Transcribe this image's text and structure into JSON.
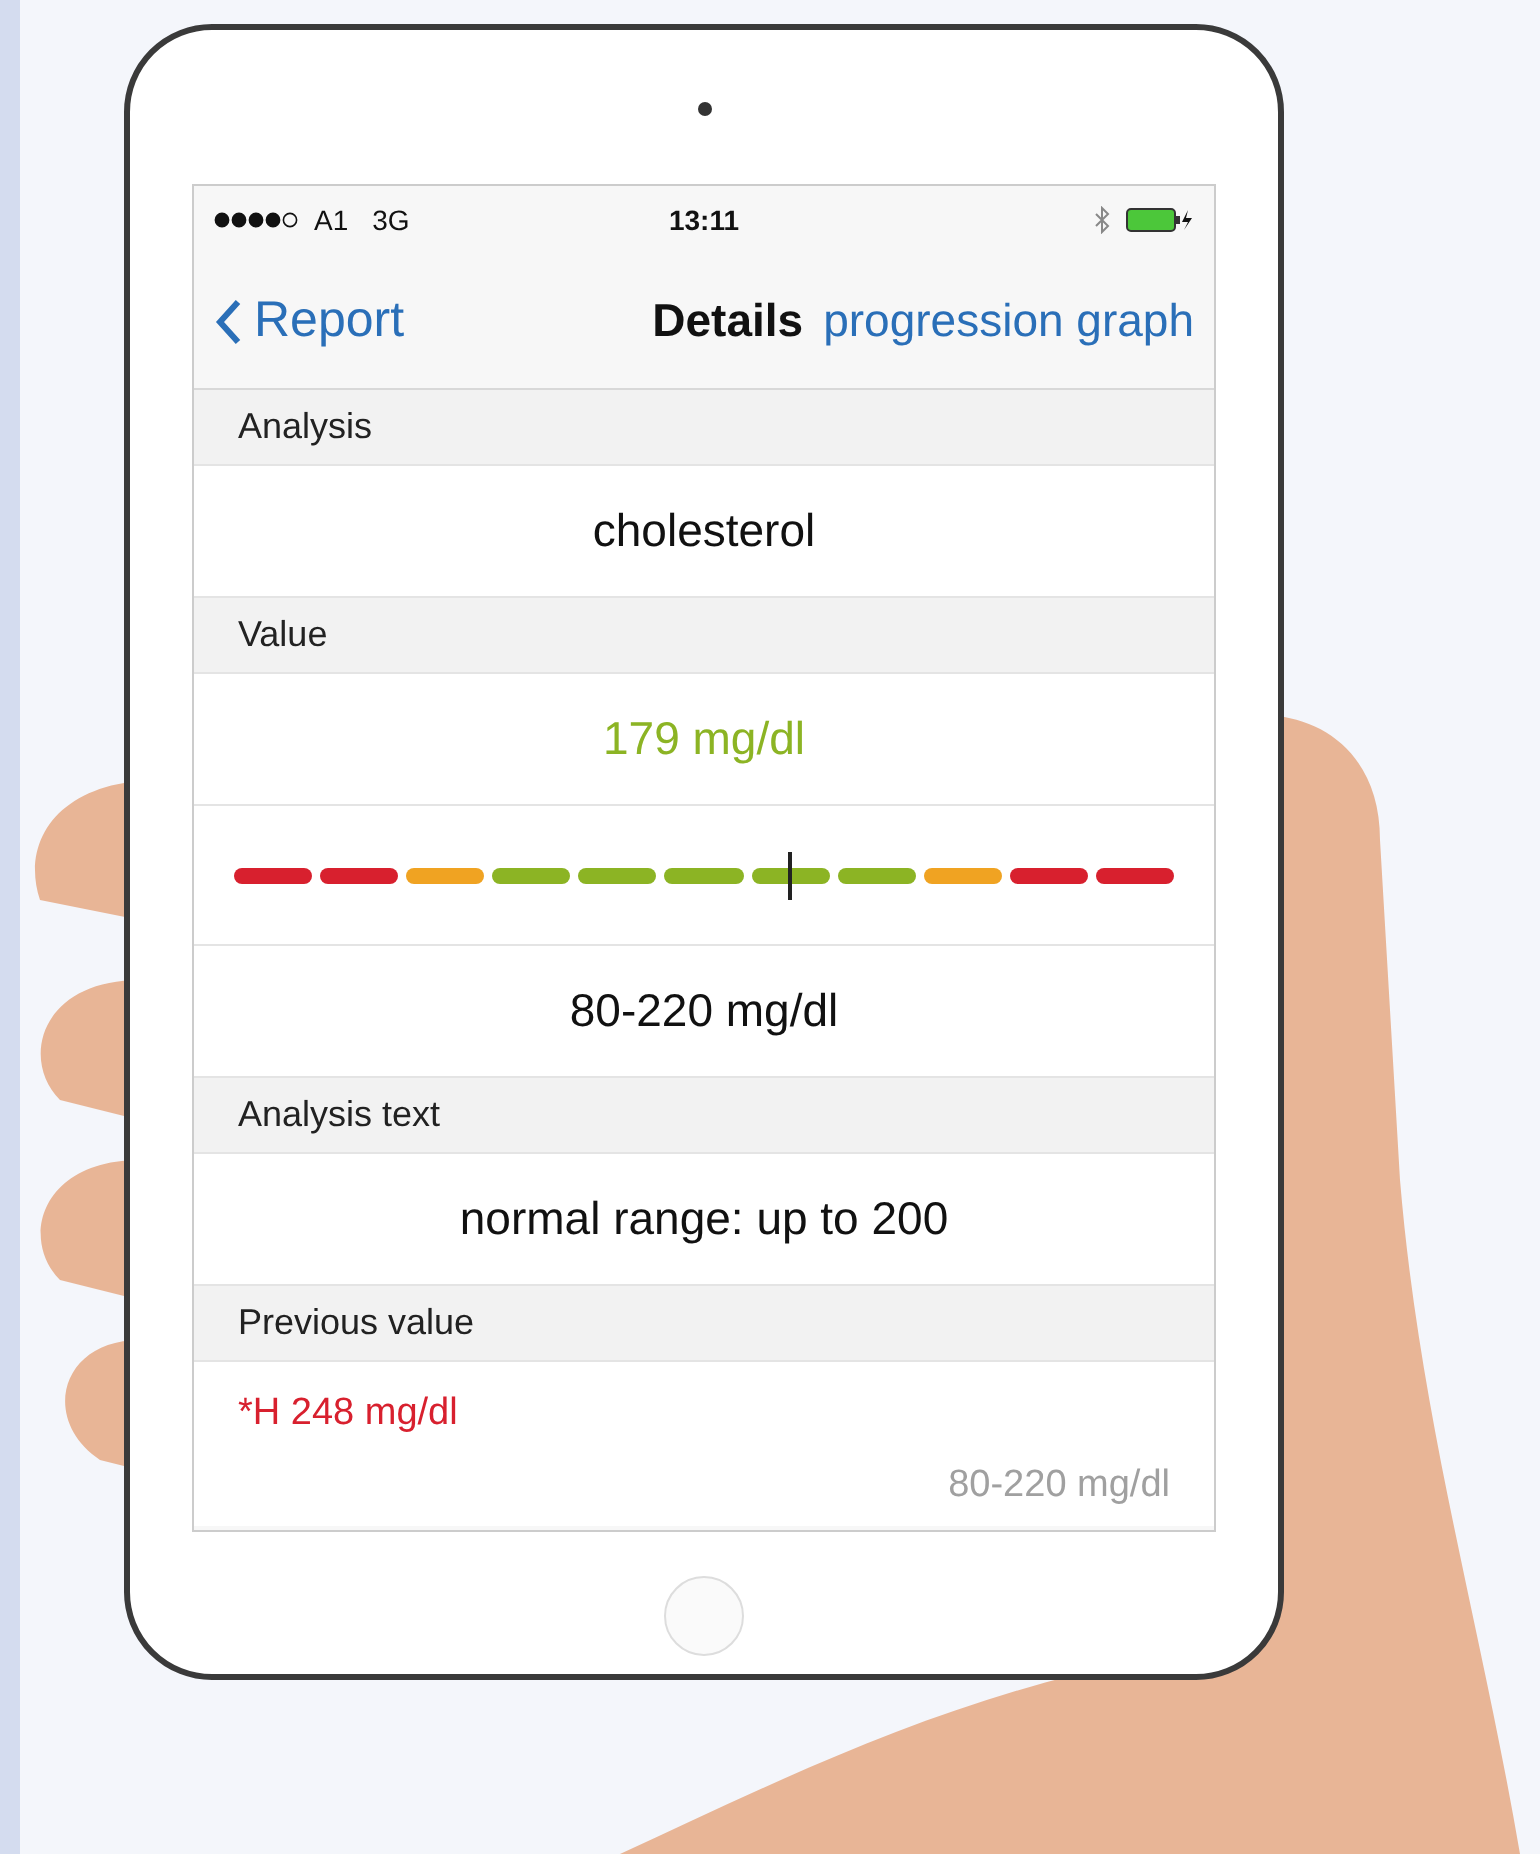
{
  "status_bar": {
    "carrier": "A1",
    "network": "3G",
    "time": "13:11"
  },
  "nav": {
    "back": "Report",
    "title": "Details",
    "action": "progression graph"
  },
  "sections": [
    {
      "header": "Analysis",
      "rows": [
        {
          "kind": "center",
          "text": "cholesterol",
          "color": "#111111"
        }
      ]
    },
    {
      "header": "Value",
      "rows": [
        {
          "kind": "center",
          "text": "179 mg/dl",
          "color": "#8cb424"
        },
        {
          "kind": "scale",
          "level": 0.59,
          "segments": [
            {
              "color": "#d8202e"
            },
            {
              "color": "#d8202e"
            },
            {
              "color": "#f0a322"
            },
            {
              "color": "#8cb424"
            },
            {
              "color": "#8cb424"
            },
            {
              "color": "#8cb424"
            },
            {
              "color": "#8cb424"
            },
            {
              "color": "#8cb424"
            },
            {
              "color": "#f0a322"
            },
            {
              "color": "#d8202e"
            },
            {
              "color": "#d8202e"
            }
          ]
        },
        {
          "kind": "center",
          "text": "80-220 mg/dl",
          "color": "#111111"
        }
      ]
    },
    {
      "header": "Analysis text",
      "rows": [
        {
          "kind": "center",
          "text": "normal range: up to 200",
          "color": "#111111"
        }
      ]
    },
    {
      "header": "Previous value",
      "rows": [
        {
          "kind": "previous",
          "text": "*H 248 mg/dl",
          "color": "#d8202e",
          "range": "80-220 mg/dl"
        }
      ]
    }
  ]
}
